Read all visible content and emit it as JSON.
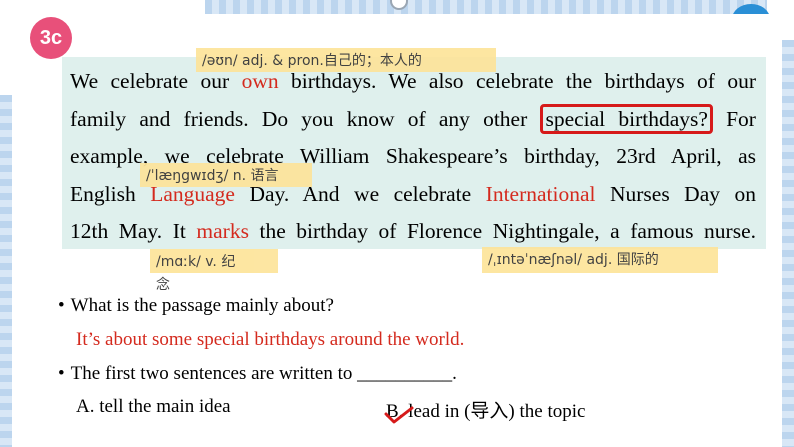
{
  "badge": "3c",
  "passage": {
    "line1": [
      "We celebrate our ",
      "own",
      " birthdays. We also celebrate the birthdays of our"
    ],
    "line2": [
      "family and friends. Do you know of any other ",
      "special birthdays?",
      " For"
    ],
    "line3": "example, we celebrate William Shakespeare’s birthday, 23rd April, as",
    "line4": [
      "English ",
      "Language",
      " Day. And we celebrate ",
      "International",
      " Nurses Day on"
    ],
    "line5": [
      "12th May. It ",
      "marks",
      " the birthday of Florence Nightingale, a famous nurse."
    ]
  },
  "notes": {
    "own": "/əʊn/ adj. & pron.自己的；本人的",
    "language": "/ˈlæŋgwɪdʒ/ n. 语言",
    "marks_a": "/mɑːk/ v. 纪",
    "marks_b": "念",
    "international": "/ˌɪntəˈnæʃnəl/ adj. 国际的"
  },
  "questions": {
    "bullet": "•",
    "q1": "What is the passage mainly about?",
    "a1": "It’s about some special birthdays around the world.",
    "q2": "The first two sentences are written to __________.",
    "optA": "A. tell the main idea",
    "optB": "B. lead in (导入) the topic"
  },
  "colors": {
    "accent_red": "#d42a1e",
    "badge": "#e8507a",
    "passage_bg": "#dff0ed",
    "note_bg": "#fde49a"
  }
}
